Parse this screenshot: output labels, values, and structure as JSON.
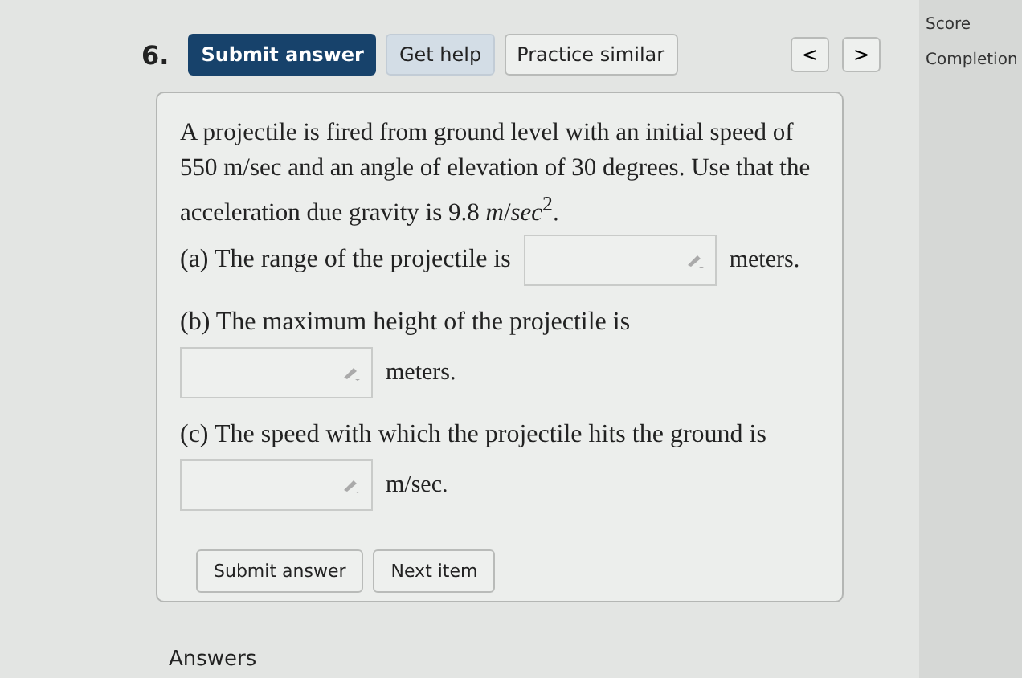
{
  "question_number": "6.",
  "toolbar": {
    "buttons": [
      {
        "label": "Submit answer",
        "kind": "primary"
      },
      {
        "label": "Get help",
        "kind": "secondary"
      },
      {
        "label": "Practice similar",
        "kind": "plain"
      }
    ],
    "nav": [
      "<",
      ">"
    ]
  },
  "side": {
    "labels": [
      "Score",
      "Completion"
    ]
  },
  "problem": {
    "text": "A projectile is fired from ground level with an initial speed of 550 m/sec and an angle of elevation of 30 degrees. Use that the acceleration due gravity is 9.8 *m*/*sec*$^{2}$.",
    "parts": [
      {
        "label": "(a) The range of the projectile is",
        "unit": "meters.",
        "kind": "inline"
      },
      {
        "label": "(b) The maximum height of the projectile is",
        "unit": "meters.",
        "kind": "below"
      },
      {
        "label": "(c) The speed with which the projectile hits the ground is",
        "unit": "m/sec.",
        "kind": "below"
      }
    ]
  },
  "actions": [
    "Submit answer",
    "Next item"
  ],
  "footer": "Answers"
}
